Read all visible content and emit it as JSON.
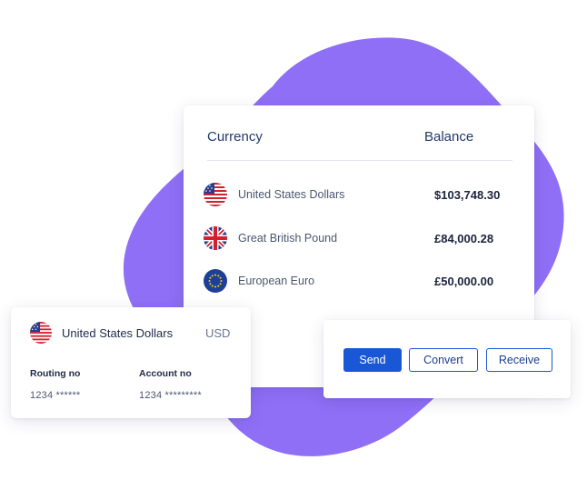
{
  "balances": {
    "headers": {
      "currency": "Currency",
      "balance": "Balance"
    },
    "rows": [
      {
        "name": "United States Dollars",
        "amount": "$103,748.30",
        "flag_icon": "us-flag-icon"
      },
      {
        "name": "Great British Pound",
        "amount": "£84,000.28",
        "flag_icon": "uk-flag-icon"
      },
      {
        "name": "European Euro",
        "amount": "£50,000.00",
        "flag_icon": "eu-flag-icon"
      }
    ]
  },
  "account": {
    "name": "United States Dollars",
    "code": "USD",
    "routing_label": "Routing no",
    "routing_value": "1234 ******",
    "account_label": "Account no",
    "account_value": "1234 *********"
  },
  "actions": {
    "send": "Send",
    "convert": "Convert",
    "receive": "Receive"
  },
  "colors": {
    "accent": "#1a57d6",
    "blob": "#9070f5",
    "text": "#1f2a4a"
  }
}
